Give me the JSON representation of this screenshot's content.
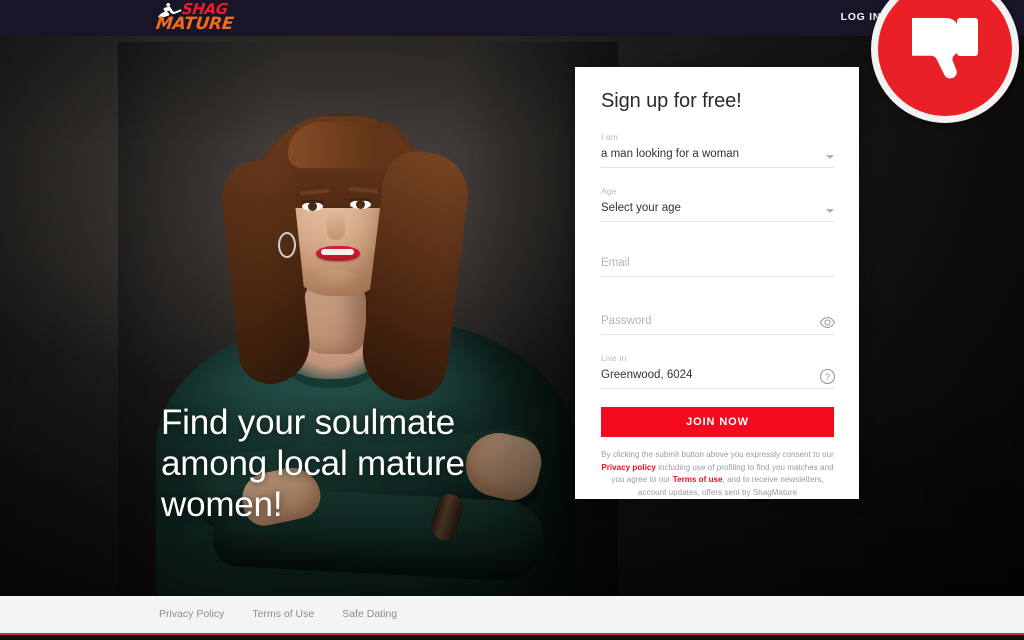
{
  "header": {
    "logo": {
      "icon": "woman-silhouette-icon",
      "word_one": "SHAG",
      "word_two": "MATURE",
      "color_one": "#ee1a2d",
      "color_two": "#f26a1b"
    },
    "login_label": "LOG IN",
    "background_color": "#191528"
  },
  "badge": {
    "icon": "thumbs-down-icon",
    "fill_color": "#ea2027",
    "ring_color": "#f2f2f2"
  },
  "hero": {
    "headline": "Find your soulmate among local mature women!",
    "image_alt": "smiling mature woman with auburn wavy hair in a dark green sweater, arms crossed",
    "background_color": "#2b2825"
  },
  "signup": {
    "title": "Sign up for free!",
    "fields": [
      {
        "name": "i-am",
        "label": "I am",
        "value": "a man looking for a woman",
        "control": "select",
        "icon": "chevron-down-icon"
      },
      {
        "name": "age",
        "label": "Age",
        "value": "Select your age",
        "control": "select",
        "icon": "chevron-down-icon"
      },
      {
        "name": "email",
        "label": "",
        "placeholder": "Email",
        "control": "text",
        "icon": ""
      },
      {
        "name": "password",
        "label": "",
        "placeholder": "Password",
        "control": "password",
        "icon": "eye-icon"
      },
      {
        "name": "live-in",
        "label": "Live in",
        "value": "Greenwood, 6024",
        "control": "text",
        "icon": "question-mark-circle-icon"
      }
    ],
    "submit_label": "JOIN NOW",
    "submit_color": "#f5091f",
    "disclaimer": {
      "part1": "By clicking the submit button above you expressly consent to our ",
      "link1": "Privacy policy",
      "part2": " including use of profiling to find you matches and you agree to our ",
      "link2": "Terms of use",
      "part3": ", and to receive newsletters, account updates, offers sent by ShagMature"
    }
  },
  "footer": {
    "links": [
      {
        "label": "Privacy Policy"
      },
      {
        "label": "Terms of Use"
      },
      {
        "label": "Safe Dating"
      }
    ],
    "background_color": "#f4f4f4",
    "rule_color": "#c0313a"
  }
}
